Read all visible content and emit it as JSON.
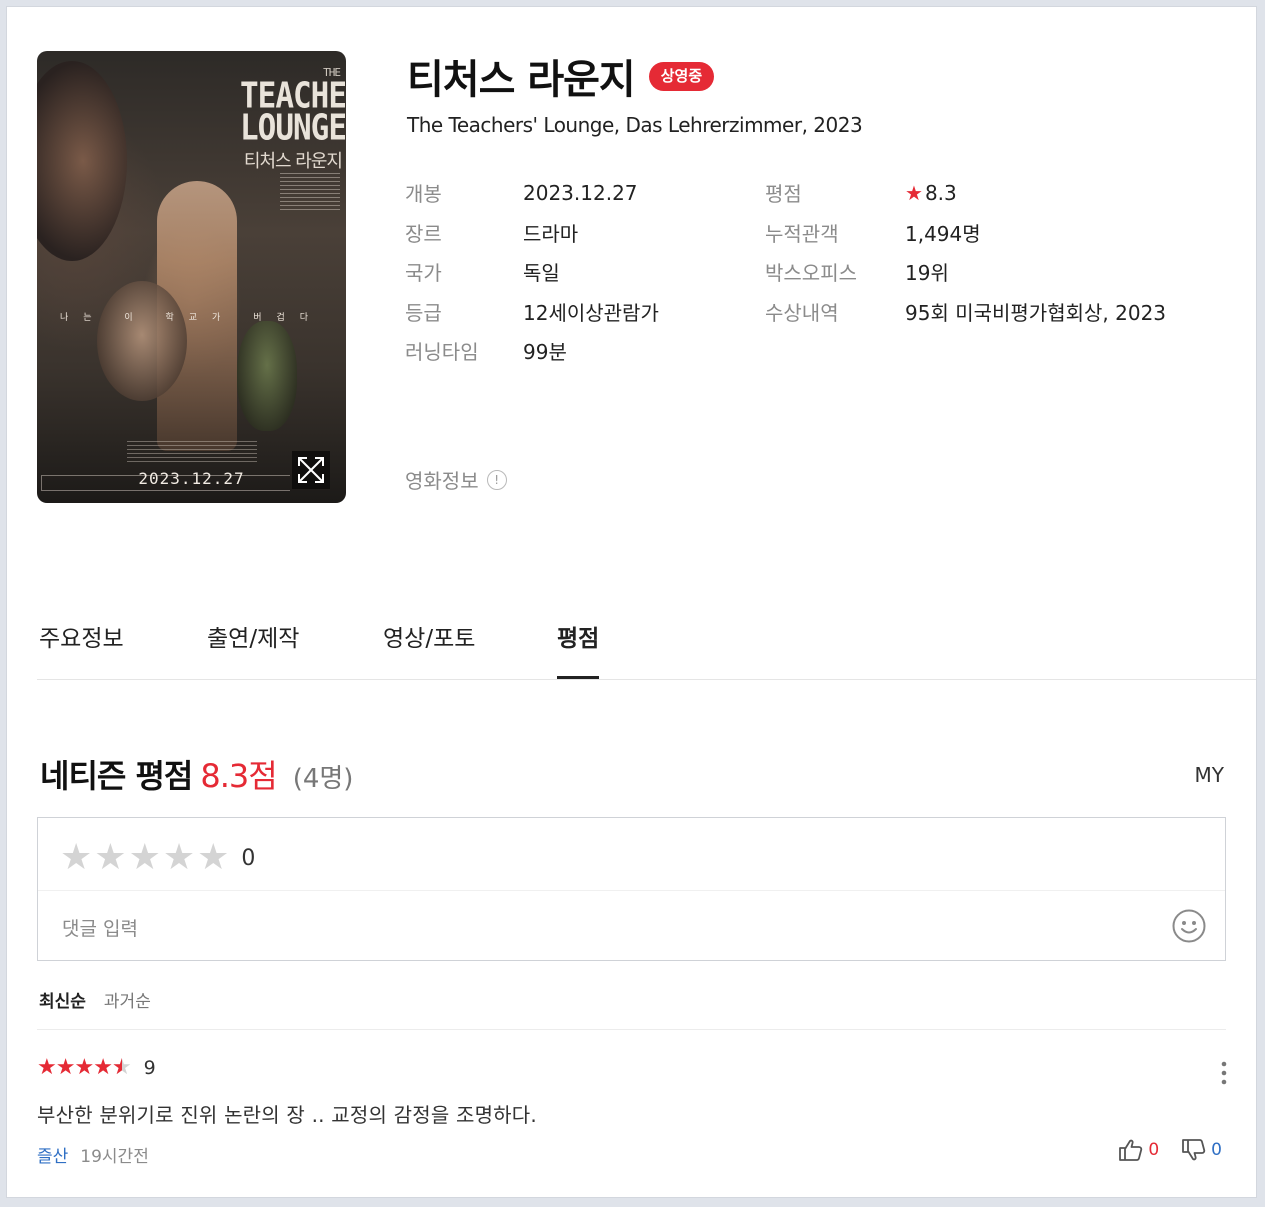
{
  "poster": {
    "en_small": "THE",
    "en_line1": "TEACHERS'",
    "en_line2": "LOUNGE",
    "ko_title": "티처스 라운지",
    "tagline": "나는 이 학교가 버겁다",
    "date": "2023.12.27"
  },
  "movie": {
    "title": "티처스 라운지",
    "status_badge": "상영중",
    "subtitle": "The Teachers' Lounge, Das Lehrerzimmer, 2023"
  },
  "info_left": [
    {
      "label": "개봉",
      "value": "2023.12.27"
    },
    {
      "label": "장르",
      "value": "드라마"
    },
    {
      "label": "국가",
      "value": "독일"
    },
    {
      "label": "등급",
      "value": "12세이상관람가"
    },
    {
      "label": "러닝타임",
      "value": "99분"
    }
  ],
  "info_right": [
    {
      "label": "평점",
      "value": "8.3"
    },
    {
      "label": "누적관객",
      "value": "1,494명"
    },
    {
      "label": "박스오피스",
      "value": "19위"
    },
    {
      "label": "수상내역",
      "value": "95회 미국비평가협회상, 2023"
    }
  ],
  "movie_info_label": "영화정보",
  "movie_info_icon": "!",
  "tabs": [
    {
      "label": "주요정보",
      "active": false
    },
    {
      "label": "출연/제작",
      "active": false
    },
    {
      "label": "영상/포토",
      "active": false
    },
    {
      "label": "평점",
      "active": true
    }
  ],
  "rating_summary": {
    "label": "네티즌 평점",
    "score": "8.3점",
    "count": "(4명)",
    "my_label": "MY"
  },
  "comment_box": {
    "stars_filled": 0,
    "stars_total": 5,
    "star_value": "0",
    "placeholder": "댓글 입력"
  },
  "sort_options": {
    "latest": "최신순",
    "oldest": "과거순"
  },
  "reviews": [
    {
      "rating": 9,
      "rating_label": "9",
      "text": "부산한 분위기로 진위 논란의 장 ..  교정의 감정을 조명하다.",
      "author": "즐산",
      "time": "19시간전",
      "likes": "0",
      "dislikes": "0"
    }
  ],
  "colors": {
    "accent_red": "#e52a35",
    "link_blue": "#2f6fc4",
    "label_gray": "#8b8b8b"
  }
}
